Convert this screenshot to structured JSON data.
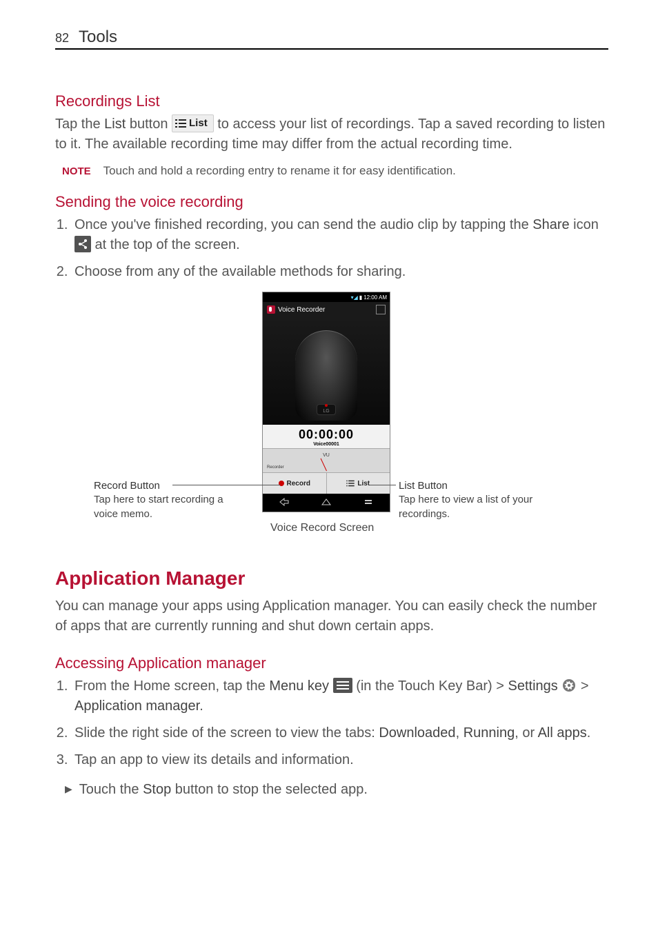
{
  "header": {
    "page_num": "82",
    "title": "Tools"
  },
  "sec1": {
    "title": "Recordings List",
    "p1_a": "Tap the ",
    "p1_list_word": "List",
    "p1_b": " button ",
    "list_btn_label": "List",
    "p1_c": " to access your list of recordings. Tap a saved recording to listen to it. The available recording time may differ from the actual recording time.",
    "note_label": "NOTE",
    "note_text": "Touch and hold a recording entry to rename it for easy identification."
  },
  "sec2": {
    "title": "Sending the voice recording",
    "li1_a": "Once you've finished recording, you can send the audio clip by tapping the ",
    "li1_share": "Share",
    "li1_b": " icon ",
    "li1_c": " at the top of the screen.",
    "li2": "Choose from any of the available methods for sharing."
  },
  "phone": {
    "status_time": "12:00 AM",
    "app_title": "Voice Recorder",
    "mic_brand": "LG",
    "timer": "00:00:00",
    "timer_sub": "Voice00001",
    "vu_label": "VU",
    "rec_tiny": "Recorder",
    "record_btn": "Record",
    "list_btn": "List"
  },
  "callouts": {
    "left_title": "Record Button",
    "left_sub": "Tap here to start recording a voice memo.",
    "center": "Voice Record Screen",
    "right_title": "List Button",
    "right_sub": "Tap here to view a list of your recordings."
  },
  "sec3": {
    "title": "Application Manager",
    "intro": "You can manage your apps using Application manager. You can easily check the number of apps that are currently running and shut down certain apps."
  },
  "sec4": {
    "title": "Accessing Application manager",
    "li1_a": "From the Home screen, tap the ",
    "li1_menu": "Menu key",
    "li1_b": " (in the Touch Key Bar) > ",
    "li1_settings": "Settings",
    "li1_c": " > ",
    "li1_appmgr": "Application manager",
    "li1_d": ".",
    "li2_a": "Slide the right side of the screen to view the tabs: ",
    "li2_dl": "Downloaded",
    "li2_b": ", ",
    "li2_run": "Running",
    "li2_c": ", or ",
    "li2_all": "All apps",
    "li2_d": ".",
    "li3": "Tap an app to view its details and information.",
    "bullet_a": "Touch the ",
    "bullet_stop": "Stop",
    "bullet_b": " button to stop the selected app."
  }
}
